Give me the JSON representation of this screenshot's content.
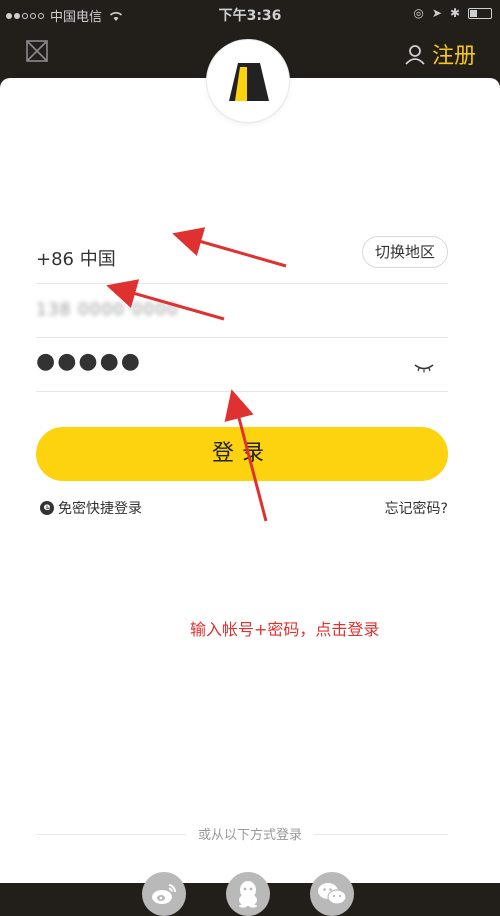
{
  "status_bar": {
    "carrier": "中国电信",
    "time": "下午3:36"
  },
  "header": {
    "close_icon": "close-square-icon",
    "register_label": "注册",
    "register_icon": "user-icon",
    "accent_color": "#f5c518"
  },
  "logo": {
    "icon": "app-logo"
  },
  "form": {
    "region_text": "+86 中国",
    "switch_region_label": "切换地区",
    "phone_value": "138 0000 0000",
    "password_value": "●●●●●",
    "eye_icon": "eye-closed-icon",
    "login_label": "登录",
    "login_color": "#fdd20e",
    "quick_login_label": "免密快捷登录",
    "forgot_password_label": "忘记密码?"
  },
  "annotation": {
    "text": "输入帐号+密码，点击登录",
    "color": "#e03131"
  },
  "other_login": {
    "divider_text": "或从以下方式登录",
    "methods": [
      "weibo-icon",
      "qq-icon",
      "wechat-icon"
    ]
  }
}
